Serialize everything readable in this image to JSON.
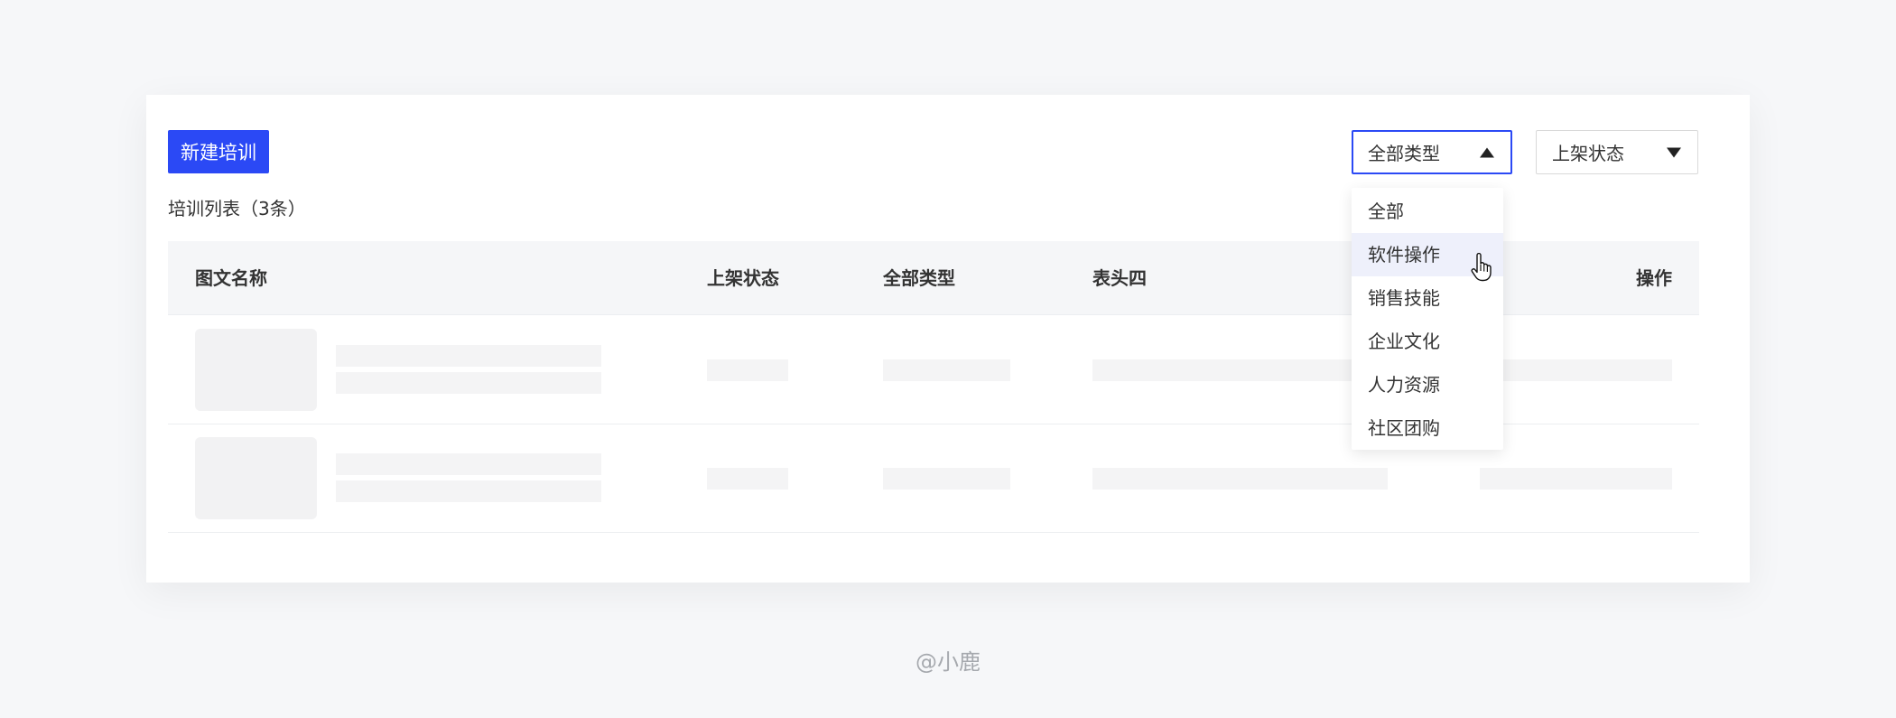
{
  "toolbar": {
    "new_button": "新建培训",
    "list_title": "培训列表（3条）"
  },
  "filters": {
    "type_select": {
      "value": "全部类型",
      "open": true
    },
    "status_select": {
      "value": "上架状态",
      "open": false
    }
  },
  "table": {
    "columns": [
      "图文名称",
      "上架状态",
      "全部类型",
      "表头四",
      "操作"
    ],
    "loading_rows": 2
  },
  "dropdown": {
    "options": [
      "全部",
      "软件操作",
      "销售技能",
      "企业文化",
      "人力资源",
      "社区团购"
    ],
    "hovered_index": 1
  },
  "icons": {
    "open_arrow": "caret-up-icon",
    "closed_arrow": "caret-down-icon",
    "cursor": "hand-pointer-icon"
  },
  "colors": {
    "primary": "#2b49f5",
    "header_bg": "#f5f6f8",
    "skeleton": "#f4f4f5",
    "hover_bg": "#eef0fb"
  },
  "watermark": "@小鹿"
}
